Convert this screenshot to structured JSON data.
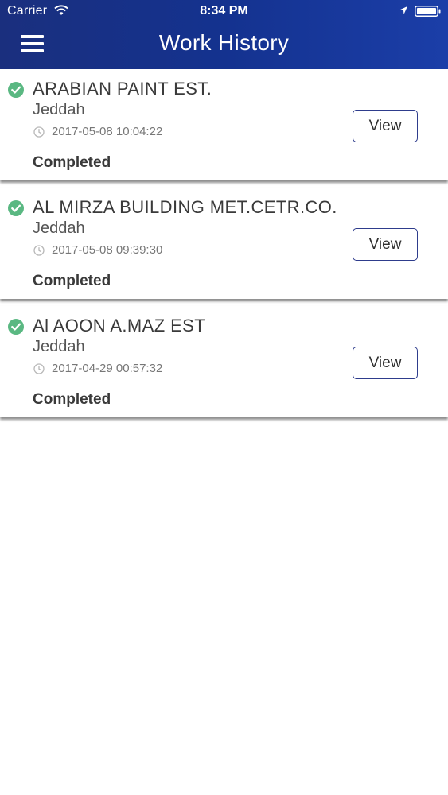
{
  "status_bar": {
    "carrier": "Carrier",
    "time": "8:34 PM"
  },
  "header": {
    "title": "Work History"
  },
  "colors": {
    "header_start": "#1a2f7e",
    "header_end": "#1b3ea8",
    "check_green": "#5ab882",
    "button_border": "#2e3c8c"
  },
  "items": [
    {
      "company": "ARABIAN PAINT EST.",
      "city": "Jeddah",
      "timestamp": "2017-05-08 10:04:22",
      "status": "Completed",
      "action": "View",
      "status_icon": "check-circle-icon"
    },
    {
      "company": "AL MIRZA BUILDING MET.CETR.CO.",
      "city": "Jeddah",
      "timestamp": "2017-05-08 09:39:30",
      "status": "Completed",
      "action": "View",
      "status_icon": "check-circle-icon"
    },
    {
      "company": "Al AOON A.MAZ EST",
      "city": "Jeddah",
      "timestamp": "2017-04-29 00:57:32",
      "status": "Completed",
      "action": "View",
      "status_icon": "check-circle-icon"
    }
  ]
}
